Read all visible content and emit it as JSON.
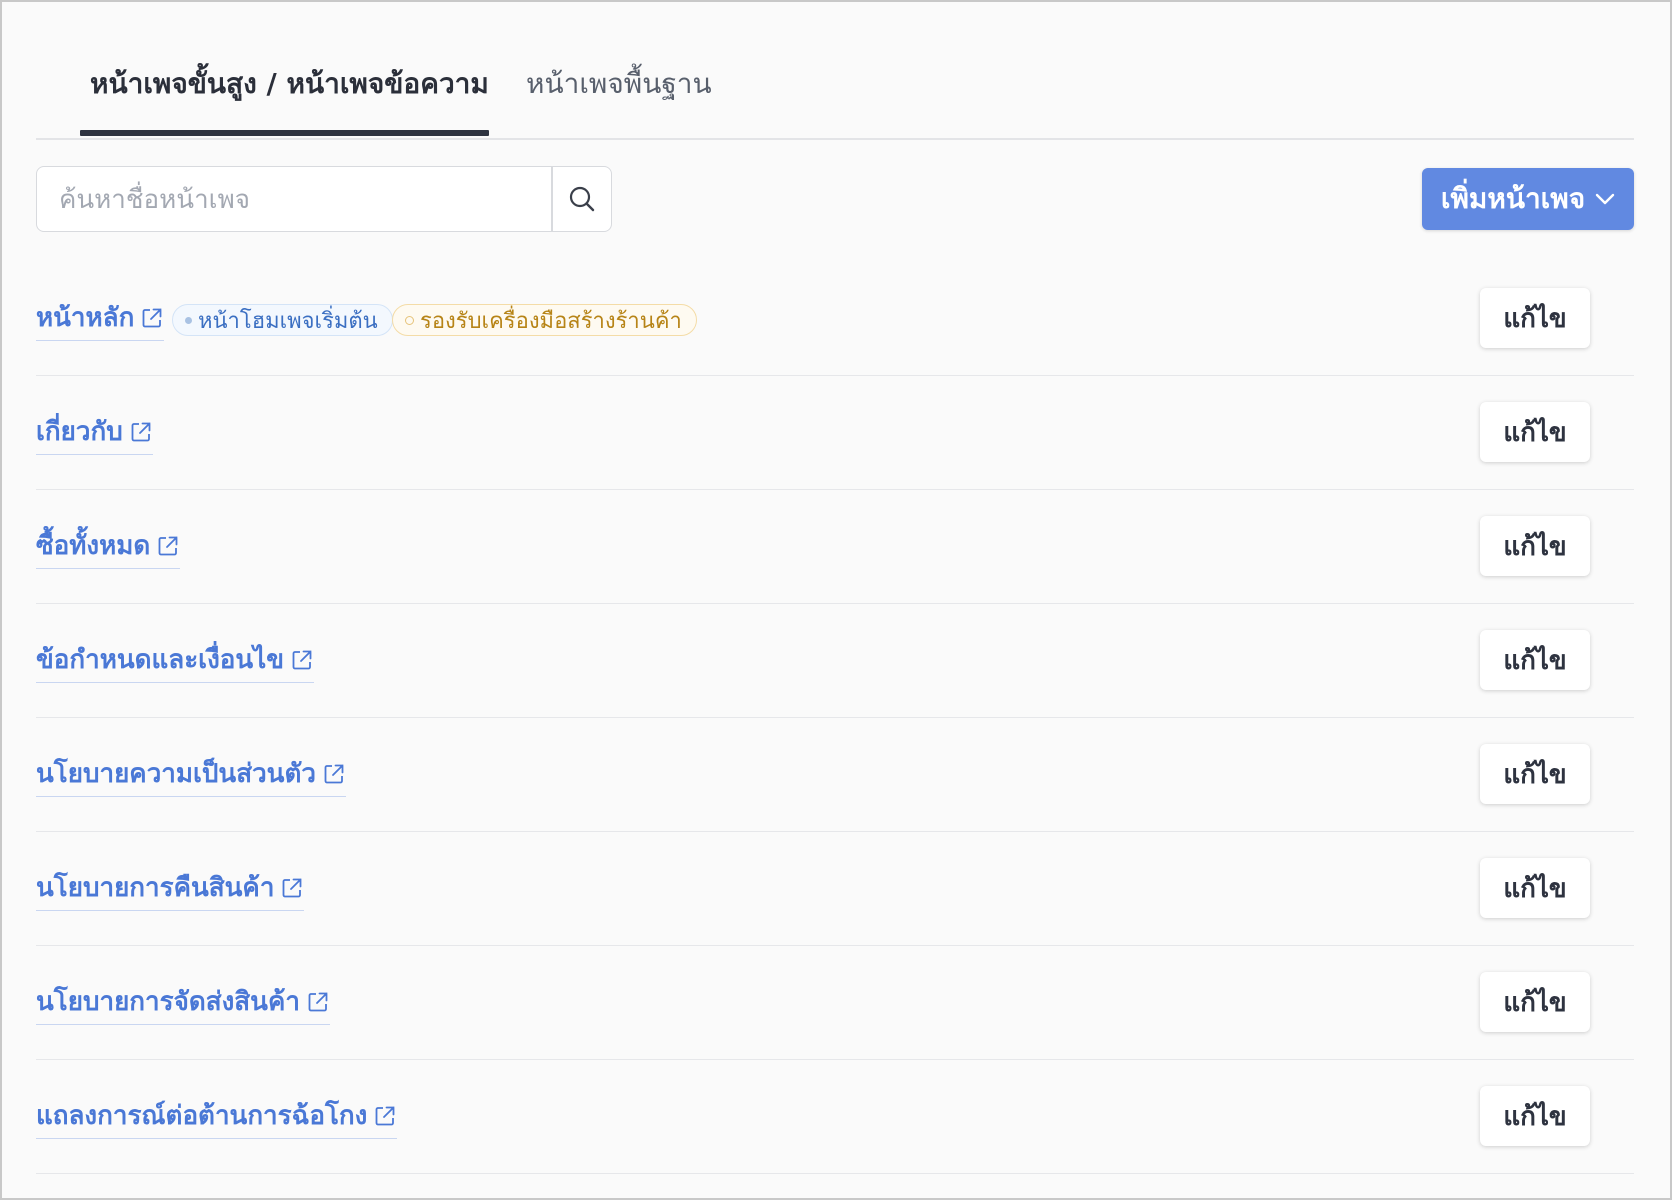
{
  "tabs": [
    {
      "label": "หน้าเพจขั้นสูง / หน้าเพจข้อความ",
      "active": true
    },
    {
      "label": "หน้าเพจพื้นฐาน",
      "active": false
    }
  ],
  "search": {
    "placeholder": "ค้นหาชื่อหน้าเพจ",
    "icon": "search-icon"
  },
  "add_button": {
    "label": "เพิ่มหน้าเพจ",
    "icon": "chevron-down-icon",
    "color": "#6189e1"
  },
  "pages": [
    {
      "title": "หน้าหลัก",
      "badges": [
        "หน้าโฮมเพจเริ่มต้น",
        "รองรับเครื่องมือสร้างร้านค้า"
      ],
      "edit_label": "แก้ไข"
    },
    {
      "title": "เกี่ยวกับ",
      "edit_label": "แก้ไข"
    },
    {
      "title": "ซื้อทั้งหมด",
      "edit_label": "แก้ไข"
    },
    {
      "title": "ข้อกำหนดและเงื่อนไข",
      "edit_label": "แก้ไข"
    },
    {
      "title": "นโยบายความเป็นส่วนตัว",
      "edit_label": "แก้ไข"
    },
    {
      "title": "นโยบายการคืนสินค้า",
      "edit_label": "แก้ไข"
    },
    {
      "title": "นโยบายการจัดส่งสินค้า",
      "edit_label": "แก้ไข"
    },
    {
      "title": "แถลงการณ์ต่อต้านการฉ้อโกง",
      "edit_label": "แก้ไข"
    }
  ],
  "colors": {
    "link": "#4a78d6",
    "home_badge": "#3b6fc2",
    "store_badge": "#b78417"
  }
}
